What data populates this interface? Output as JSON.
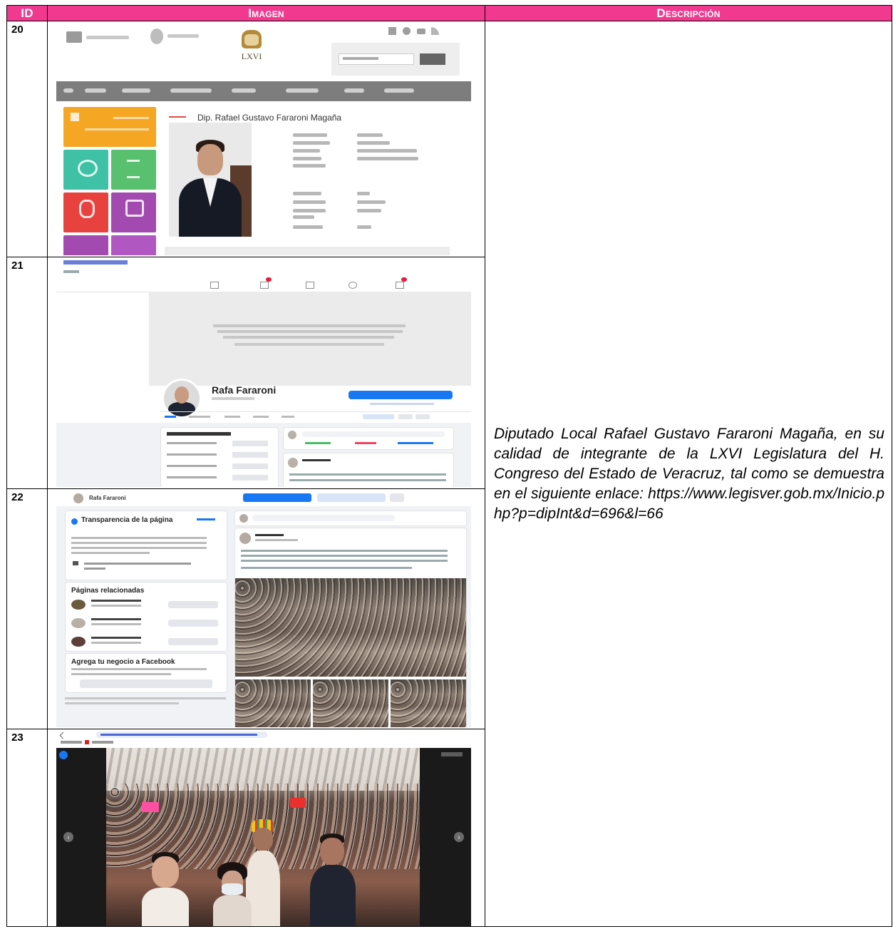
{
  "headers": {
    "id": "ID",
    "image": "Imagen",
    "description": "Descripción"
  },
  "rows": [
    {
      "id": "20"
    },
    {
      "id": "21"
    },
    {
      "id": "22"
    },
    {
      "id": "23"
    }
  ],
  "description": {
    "text": "Diputado Local Rafael Gustavo Fararoni Magaña, en su calidad de integrante de la LXVI Legislatura del H. Congreso del Estado de Veracruz, tal como se demuestra en el siguiente enlace:",
    "url": "https://www.legisver.gob.mx/Inicio.php?p=dipInt&d=696&l=66"
  },
  "shot20": {
    "logo_text": "LXVI",
    "deputy_name": "Dip. Rafael Gustavo Fararoni Magaña",
    "colors": {
      "nav": "#7d7d7d",
      "orange": "#f5a623",
      "teal": "#3fc1a5",
      "green": "#58c06f",
      "red": "#e8423f",
      "purple": "#a24ab0"
    }
  },
  "shot21": {
    "page_name": "Rafa Fararoni",
    "colors": {
      "fb_blue": "#1877f2"
    }
  },
  "shot22": {
    "page_name": "Rafa Fararoni",
    "transparency_title": "Transparencia de la página",
    "related_title": "Páginas relacionadas",
    "business_title": "Agrega tu negocio a Facebook"
  }
}
